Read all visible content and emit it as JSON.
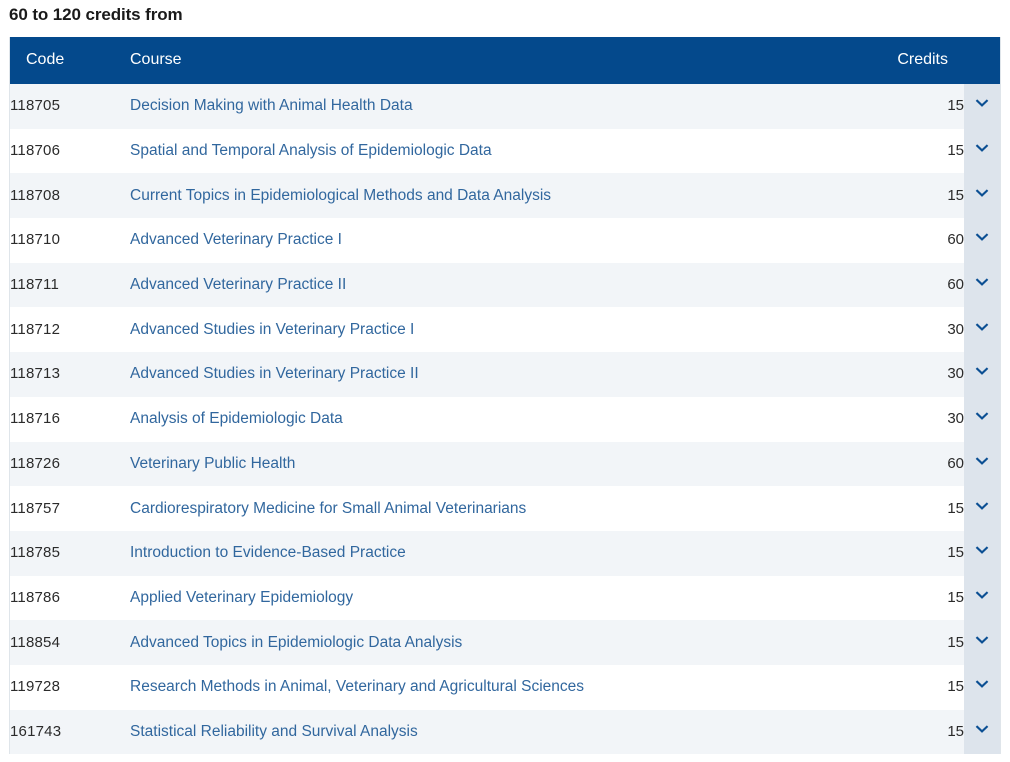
{
  "page": {
    "heading": "60 to 120 credits from"
  },
  "colors": {
    "header_bg": "#04498c",
    "link": "#31679e",
    "row_odd_bg": "#f2f5f8",
    "row_even_bg": "#ffffff",
    "toggle_col_bg": "#dde4ec",
    "chevron": "#0b4f93",
    "title_text": "#1a1a1a"
  },
  "table": {
    "columns": {
      "code": "Code",
      "course": "Course",
      "credits": "Credits",
      "toggle": ""
    },
    "toggle_icon": "chevron-down-icon",
    "rows": [
      {
        "code": "118705",
        "course": "Decision Making with Animal Health Data",
        "credits": "15"
      },
      {
        "code": "118706",
        "course": "Spatial and Temporal Analysis of Epidemiologic Data",
        "credits": "15"
      },
      {
        "code": "118708",
        "course": "Current Topics in Epidemiological Methods and Data Analysis",
        "credits": "15"
      },
      {
        "code": "118710",
        "course": "Advanced Veterinary Practice I",
        "credits": "60"
      },
      {
        "code": "118711",
        "course": "Advanced Veterinary Practice II",
        "credits": "60"
      },
      {
        "code": "118712",
        "course": "Advanced Studies in Veterinary Practice I",
        "credits": "30"
      },
      {
        "code": "118713",
        "course": "Advanced Studies in Veterinary Practice II",
        "credits": "30"
      },
      {
        "code": "118716",
        "course": "Analysis of Epidemiologic Data",
        "credits": "30"
      },
      {
        "code": "118726",
        "course": "Veterinary Public Health",
        "credits": "60"
      },
      {
        "code": "118757",
        "course": "Cardiorespiratory Medicine for Small Animal Veterinarians",
        "credits": "15"
      },
      {
        "code": "118785",
        "course": "Introduction to Evidence-Based Practice",
        "credits": "15"
      },
      {
        "code": "118786",
        "course": "Applied Veterinary Epidemiology",
        "credits": "15"
      },
      {
        "code": "118854",
        "course": "Advanced Topics in Epidemiologic Data Analysis",
        "credits": "15"
      },
      {
        "code": "119728",
        "course": "Research Methods in Animal, Veterinary and Agricultural Sciences",
        "credits": "15"
      },
      {
        "code": "161743",
        "course": "Statistical Reliability and Survival Analysis",
        "credits": "15"
      }
    ]
  }
}
